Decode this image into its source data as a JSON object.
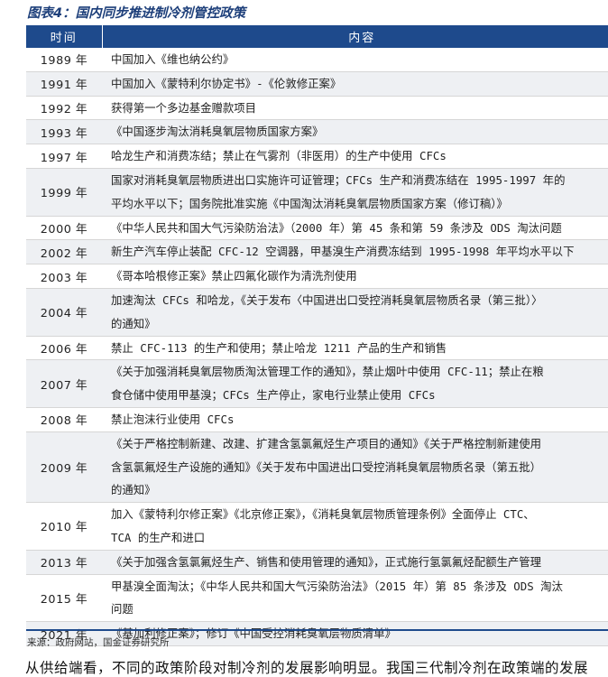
{
  "figure": {
    "title": "图表4：国内同步推进制冷剂管控政策",
    "source": "来源：政府网站，国金证券研究所"
  },
  "table": {
    "headers": {
      "year": "时间",
      "content": "内容"
    },
    "rows": [
      {
        "year": "1989 年",
        "lines": [
          "中国加入《维也纳公约》"
        ]
      },
      {
        "year": "1991 年",
        "lines": [
          "中国加入《蒙特利尔协定书》-《伦敦修正案》"
        ]
      },
      {
        "year": "1992 年",
        "lines": [
          "获得第一个多边基金赠款项目"
        ]
      },
      {
        "year": "1993 年",
        "lines": [
          "《中国逐步淘汰消耗臭氧层物质国家方案》"
        ]
      },
      {
        "year": "1997 年",
        "lines": [
          "哈龙生产和消费冻结；禁止在气雾剂（非医用）的生产中使用 CFCs"
        ]
      },
      {
        "year": "1999 年",
        "lines": [
          "国家对消耗臭氧层物质进出口实施许可证管理；CFCs 生产和消费冻结在 1995-1997 年的",
          "平均水平以下；国务院批准实施《中国淘汰消耗臭氧层物质国家方案（修订稿）》"
        ]
      },
      {
        "year": "2000 年",
        "lines": [
          "《中华人民共和国大气污染防治法》（2000 年）第 45 条和第 59 条涉及 ODS 淘汰问题"
        ]
      },
      {
        "year": "2002 年",
        "lines": [
          "新生产汽车停止装配 CFC-12 空调器，甲基溴生产消费冻结到 1995-1998 年平均水平以下"
        ]
      },
      {
        "year": "2003 年",
        "lines": [
          "《哥本哈根修正案》禁止四氟化碳作为清洗剂使用"
        ]
      },
      {
        "year": "2004 年",
        "lines": [
          "加速淘汰 CFCs 和哈龙，《关于发布〈中国进出口受控消耗臭氧层物质名录（第三批）〉",
          "的通知》"
        ]
      },
      {
        "year": "2006 年",
        "lines": [
          "禁止 CFC-113 的生产和使用；禁止哈龙 1211 产品的生产和销售"
        ]
      },
      {
        "year": "2007 年",
        "lines": [
          "《关于加强消耗臭氧层物质淘汰管理工作的通知》，禁止烟叶中使用 CFC-11；禁止在粮",
          "食仓储中使用甲基溴；CFCs 生产停止，家电行业禁止使用 CFCs"
        ]
      },
      {
        "year": "2008 年",
        "lines": [
          "禁止泡沫行业使用 CFCs"
        ]
      },
      {
        "year": "2009 年",
        "lines": [
          "《关于严格控制新建、改建、扩建含氢氯氟烃生产项目的通知》《关于严格控制新建使用",
          "含氢氯氟烃生产设施的通知》《关于发布中国进出口受控消耗臭氧层物质名录（第五批）",
          "的通知》"
        ]
      },
      {
        "year": "2010 年",
        "lines": [
          "加入《蒙特利尔修正案》《北京修正案》，《消耗臭氧层物质管理条例》全面停止 CTC、",
          "TCA 的生产和进口"
        ]
      },
      {
        "year": "2013 年",
        "lines": [
          "《关于加强含氢氯氟烃生产、销售和使用管理的通知》，正式施行氢氯氟烃配额生产管理"
        ]
      },
      {
        "year": "2015 年",
        "lines": [
          "甲基溴全面淘汰；《中华人民共和国大气污染防治法》（2015 年）第 85 条涉及 ODS 淘汰",
          "问题"
        ]
      },
      {
        "year": "2021 年",
        "lines": [
          "《基加利修正案》；修订《中国受控消耗臭氧层物质清单》"
        ]
      }
    ]
  },
  "body": {
    "text": "从供给端看，不同的政策阶段对制冷剂的发展影响明显。我国三代制冷剂在政策端的发展"
  }
}
